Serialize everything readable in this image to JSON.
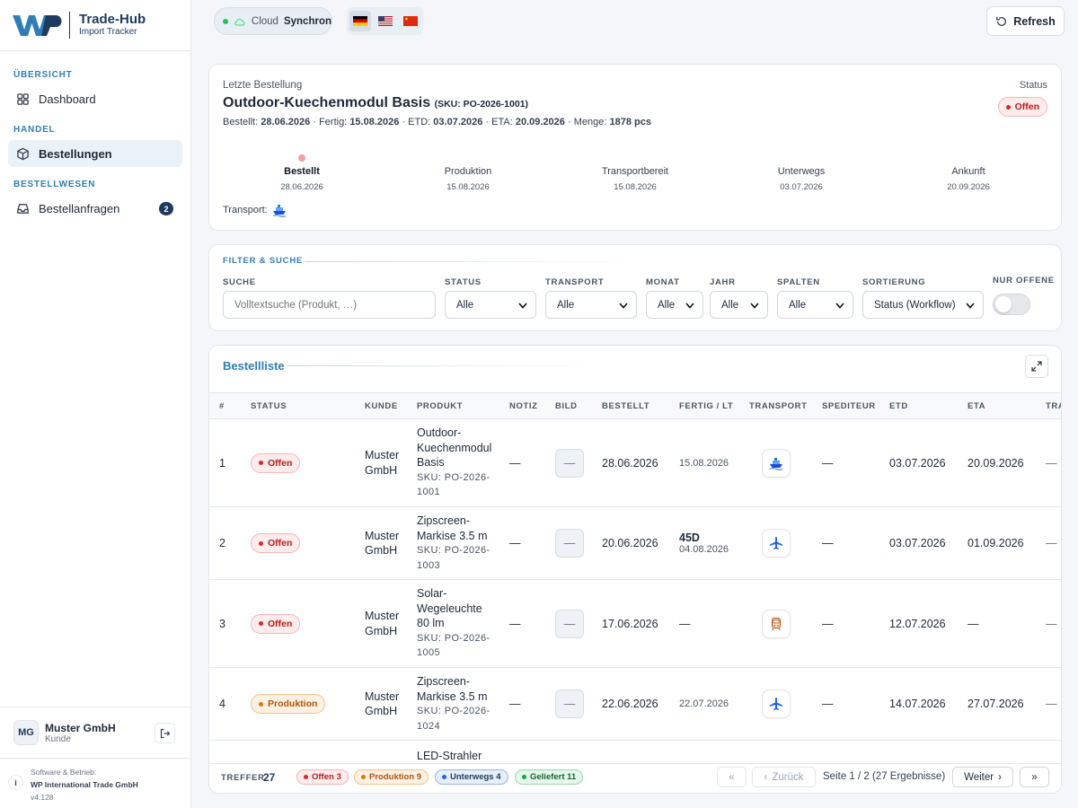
{
  "brand": {
    "title": "Trade-Hub",
    "subtitle": "Import Tracker"
  },
  "sidebar": {
    "sections": [
      {
        "label": "ÜBERSICHT",
        "items": [
          {
            "label": "Dashboard",
            "icon": "grid-icon"
          }
        ]
      },
      {
        "label": "HANDEL",
        "items": [
          {
            "label": "Bestellungen",
            "icon": "box-icon",
            "active": true
          }
        ]
      },
      {
        "label": "BESTELLWESEN",
        "items": [
          {
            "label": "Bestellanfragen",
            "icon": "inbox-icon",
            "badge": "2"
          }
        ]
      }
    ],
    "user": {
      "initials": "MG",
      "name": "Muster GmbH",
      "role": "Kunde"
    },
    "footer": {
      "line1": "Software & Betrieb:",
      "line2": "WP International Trade GmbH",
      "version": "v4.128",
      "info": "i"
    }
  },
  "topbar": {
    "cloud_label": "Cloud",
    "cloud_status": "Synchron",
    "languages": [
      "de-flag",
      "us-flag",
      "cn-flag"
    ],
    "selected_language": "de-flag",
    "refresh_label": "Refresh"
  },
  "last_order": {
    "heading": "Letzte Bestellung",
    "product": "Outdoor-Kuechenmodul Basis",
    "sku": "(SKU: PO-2026-1001)",
    "status_label": "Status",
    "status": "Offen",
    "meta": {
      "bestellt_lbl": "Bestellt:",
      "bestellt": "28.06.2026",
      "fertig_lbl": "Fertig:",
      "fertig": "15.08.2026",
      "etd_lbl": "ETD:",
      "etd": "03.07.2026",
      "eta_lbl": "ETA:",
      "eta": "20.09.2026",
      "menge_lbl": "Menge:",
      "menge": "1878 pcs",
      "sep": "·"
    },
    "timeline": [
      {
        "name": "Bestellt",
        "date": "28.06.2026",
        "current": true
      },
      {
        "name": "Produktion",
        "date": "15.08.2026"
      },
      {
        "name": "Transportbereit",
        "date": "15.08.2026"
      },
      {
        "name": "Unterwegs",
        "date": "03.07.2026"
      },
      {
        "name": "Ankunft",
        "date": "20.09.2026"
      }
    ],
    "transport_label": "Transport:"
  },
  "filter": {
    "title": "FILTER & SUCHE",
    "search_label": "SUCHE",
    "search_placeholder": "Volltextsuche (Produkt, …)",
    "status_label": "STATUS",
    "status_value": "Alle",
    "transport_label": "TRANSPORT",
    "transport_value": "Alle",
    "monat_label": "MONAT",
    "monat_value": "Alle",
    "jahr_label": "JAHR",
    "jahr_value": "Alle",
    "spalten_label": "SPALTEN",
    "spalten_value": "Alle",
    "sort_label": "SORTIERUNG",
    "sort_value": "Status (Workflow)",
    "only_open_label": "NUR OFFENE",
    "only_open": false
  },
  "list": {
    "title": "Bestellliste",
    "columns": [
      "#",
      "STATUS",
      "KUNDE",
      "PRODUKT",
      "NOTIZ",
      "BILD",
      "BESTELLT",
      "FERTIG / LT",
      "TRANSPORT",
      "SPEDITEUR",
      "ETD",
      "ETA",
      "TRA"
    ],
    "rows": [
      {
        "n": "1",
        "status": "Offen",
        "kunde1": "Muster",
        "kunde2": "GmbH",
        "prod": [
          "Outdoor-",
          "Kuechenmodul",
          "Basis"
        ],
        "sku": [
          "SKU: PO-2026-",
          "1001"
        ],
        "notiz": "—",
        "bild": "—",
        "bestellt": "28.06.2026",
        "fertig": "",
        "fertig_sub": "15.08.2026",
        "transport": "ship-icon",
        "spediteur": "—",
        "etd": "03.07.2026",
        "eta": "20.09.2026",
        "tra": "—"
      },
      {
        "n": "2",
        "status": "Offen",
        "kunde1": "Muster",
        "kunde2": "GmbH",
        "prod": [
          "Zipscreen-",
          "Markise 3.5 m"
        ],
        "sku": [
          "SKU: PO-2026-",
          "1003"
        ],
        "notiz": "—",
        "bild": "—",
        "bestellt": "20.06.2026",
        "fertig": "45D",
        "fertig_sub": "04.08.2026",
        "transport": "plane-icon",
        "spediteur": "—",
        "etd": "03.07.2026",
        "eta": "01.09.2026",
        "tra": "—"
      },
      {
        "n": "3",
        "status": "Offen",
        "kunde1": "Muster",
        "kunde2": "GmbH",
        "prod": [
          "Solar-",
          "Wegeleuchte",
          "80 lm"
        ],
        "sku": [
          "SKU: PO-2026-",
          "1005"
        ],
        "notiz": "—",
        "bild": "—",
        "bestellt": "17.06.2026",
        "fertig": "—",
        "fertig_sub": "",
        "transport": "train-icon",
        "spediteur": "—",
        "etd": "12.07.2026",
        "eta": "—",
        "tra": "—"
      },
      {
        "n": "4",
        "status": "Produktion",
        "kunde1": "Muster",
        "kunde2": "GmbH",
        "prod": [
          "Zipscreen-",
          "Markise 3.5 m"
        ],
        "sku": [
          "SKU: PO-2026-",
          "1024"
        ],
        "notiz": "—",
        "bild": "—",
        "bestellt": "22.06.2026",
        "fertig": "",
        "fertig_sub": "22.07.2026",
        "transport": "plane-icon",
        "spediteur": "—",
        "etd": "14.07.2026",
        "eta": "27.07.2026",
        "tra": "—"
      },
      {
        "n": "",
        "status": "",
        "kunde1": "",
        "kunde2": "",
        "prod": [
          "LED-Strahler"
        ],
        "sku": [],
        "notiz": "",
        "bild": "",
        "bestellt": "",
        "fertig": "",
        "fertig_sub": "",
        "transport": "",
        "spediteur": "",
        "etd": "",
        "eta": "",
        "tra": ""
      }
    ]
  },
  "pager": {
    "hits_label": "TREFFER",
    "hits": "27",
    "counts": [
      {
        "label": "Offen 3",
        "kind": "offen"
      },
      {
        "label": "Produktion 9",
        "kind": "prod"
      },
      {
        "label": "Unterwegs 4",
        "kind": "unter"
      },
      {
        "label": "Geliefert 11",
        "kind": "lief"
      }
    ],
    "first": "«",
    "back": "Zurück",
    "page_info": "Seite 1 / 2 (27 Ergebnisse)",
    "next": "Weiter",
    "last": "»"
  },
  "colors": {
    "brand": "#1e3a5f",
    "accent": "#2f7fb6",
    "offen": "#dc2626",
    "produktion": "#d97706",
    "unterwegs": "#2563eb",
    "geliefert": "#16a34a"
  }
}
